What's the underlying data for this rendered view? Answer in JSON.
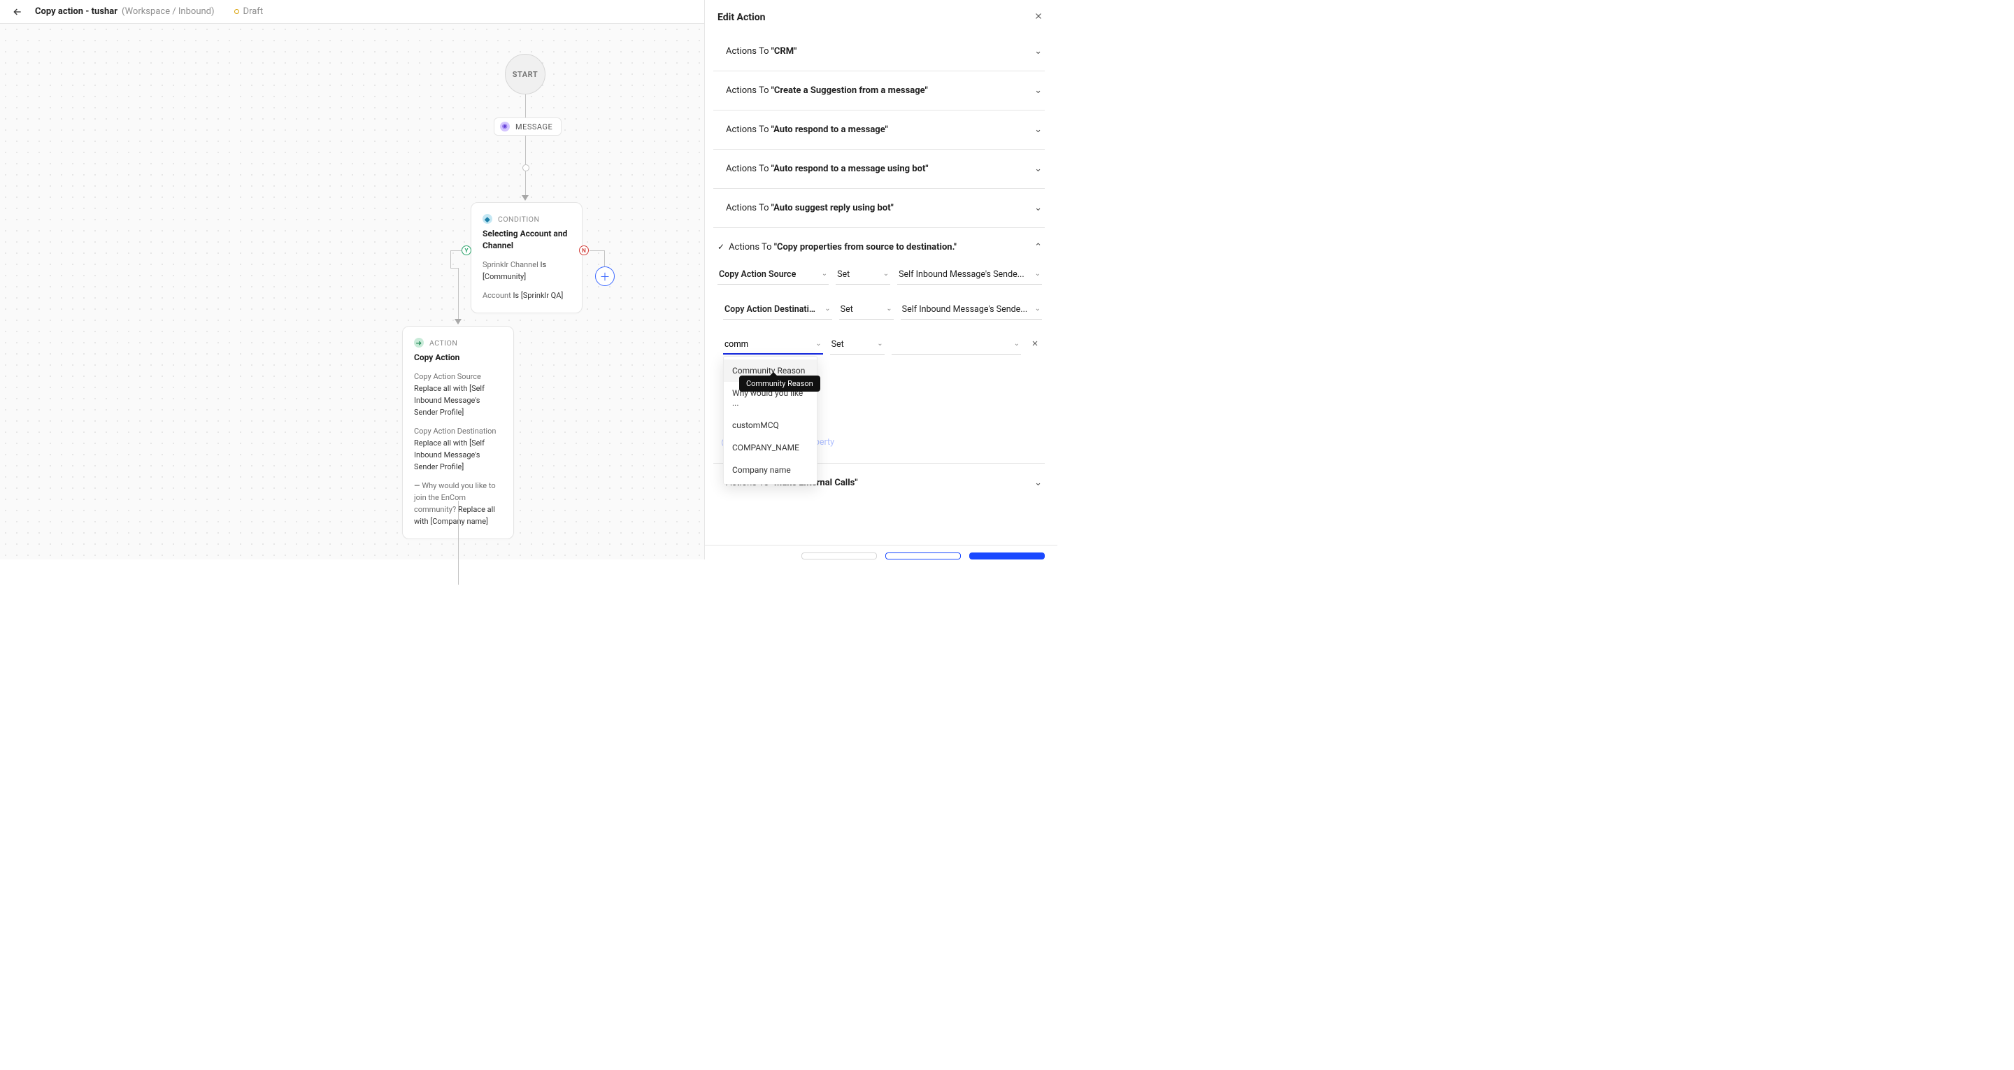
{
  "header": {
    "title_prefix": "Copy action - tushar",
    "title_suffix": "(Workspace / Inbound)",
    "status": "Draft"
  },
  "canvas": {
    "start": "START",
    "message": "MESSAGE",
    "condition": {
      "tag": "CONDITION",
      "title": "Selecting Account and Channel",
      "rule1_field": "Sprinklr Channel ",
      "rule1_op": "Is ",
      "rule1_val": "[Community]",
      "rule2_field": "Account ",
      "rule2_op": "Is ",
      "rule2_val": "[Sprinklr QA]"
    },
    "yn": {
      "y": "Y",
      "n": "N"
    },
    "action": {
      "tag": "ACTION",
      "title": "Copy Action",
      "l1a": "Copy Action Source ",
      "l1b": "Replace all with [Self Inbound Message's Sender Profile]",
      "l2a": "Copy Action Destination ",
      "l2b": "Replace all with [Self Inbound Message's Sender Profile]",
      "l3a": "— ",
      "l3b": "Why would you like to join the EnCom community? ",
      "l3c": "Replace all with [Company name]"
    }
  },
  "panel": {
    "title": "Edit Action",
    "sections": [
      {
        "label": "Actions To ",
        "value": "\"CRM\""
      },
      {
        "label": "Actions To ",
        "value": "\"Create a Suggestion from a message\""
      },
      {
        "label": "Actions To ",
        "value": "\"Auto respond to a message\""
      },
      {
        "label": "Actions To ",
        "value": "\"Auto respond to a message using bot\""
      },
      {
        "label": "Actions To ",
        "value": "\"Auto suggest reply using bot\""
      }
    ],
    "open_section": {
      "label": "Actions To ",
      "value": "\"Copy properties from source to destination.\""
    },
    "last_section": {
      "label": "Actions To ",
      "value": "\"Make External Calls\""
    },
    "row1": {
      "a": "Copy Action Source",
      "b": "Set",
      "c": "Self Inbound Message's Sende..."
    },
    "row2": {
      "a": "Copy Action Destination",
      "b": "Set",
      "c": "Self Inbound Message's Sende..."
    },
    "row3": {
      "search": "comm",
      "b": "Set",
      "c": ""
    },
    "options": [
      "Community Reason",
      "Why would you like ...",
      "customMCQ",
      "COMPANY_NAME",
      "Company name"
    ],
    "tooltip": "Community Reason",
    "add_destination": "Add Destination Property"
  }
}
